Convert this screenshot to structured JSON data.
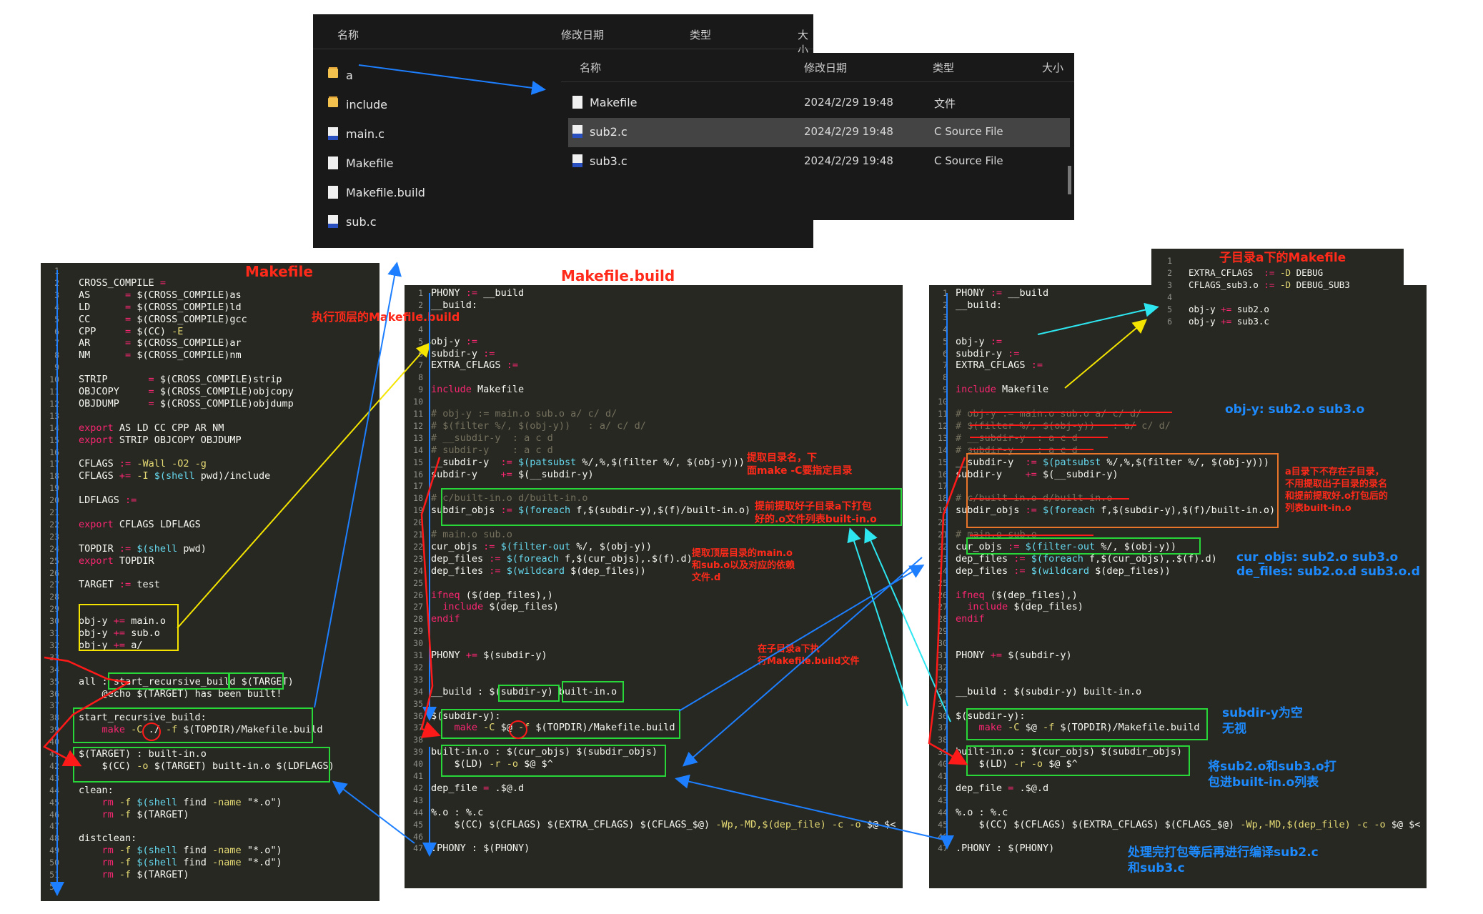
{
  "explorer1": {
    "headers": {
      "name": "名称",
      "date": "修改日期",
      "type": "类型",
      "size": "大小"
    },
    "items": [
      {
        "label": "a",
        "icon": "folder-icon"
      },
      {
        "label": "include",
        "icon": "folder-icon"
      },
      {
        "label": "main.c",
        "icon": "c-file-icon"
      },
      {
        "label": "Makefile",
        "icon": "file-icon"
      },
      {
        "label": "Makefile.build",
        "icon": "file-icon"
      },
      {
        "label": "sub.c",
        "icon": "c-file-icon"
      }
    ]
  },
  "explorer2": {
    "headers": {
      "name": "名称",
      "date": "修改日期",
      "type": "类型",
      "size": "大小"
    },
    "items": [
      {
        "label": "Makefile",
        "date": "2024/2/29 19:48",
        "type": "文件",
        "icon": "file-icon"
      },
      {
        "label": "sub2.c",
        "date": "2024/2/29 19:48",
        "type": "C Source File",
        "icon": "c-file-icon",
        "selected": true
      },
      {
        "label": "sub3.c",
        "date": "2024/2/29 19:48",
        "type": "C Source File",
        "icon": "c-file-icon"
      }
    ]
  },
  "makefile_top": {
    "line_numbers": [
      "1",
      "2",
      "3",
      "4",
      "5",
      "6",
      "7",
      "8",
      "9",
      "10",
      "11",
      "12",
      "13",
      "14",
      "15",
      "16",
      "17",
      "18",
      "19",
      "20",
      "21",
      "22",
      "23",
      "24",
      "25",
      "26",
      "27",
      "28",
      "29",
      "30",
      "31",
      "32",
      "33",
      "34",
      "35",
      "36",
      "37",
      "38",
      "39",
      "40",
      "41",
      "42",
      "43",
      "44",
      "45",
      "46",
      "47",
      "48",
      "49",
      "50",
      "51",
      "52"
    ],
    "lines": [
      {
        "n": 2,
        "t": "CROSS_COMPILE ="
      },
      {
        "n": 3,
        "t": "AS      = $(CROSS_COMPILE)as"
      },
      {
        "n": 4,
        "t": "LD      = $(CROSS_COMPILE)ld"
      },
      {
        "n": 5,
        "t": "CC      = $(CROSS_COMPILE)gcc"
      },
      {
        "n": 6,
        "t": "CPP     = $(CC) -E"
      },
      {
        "n": 7,
        "t": "AR      = $(CROSS_COMPILE)ar"
      },
      {
        "n": 8,
        "t": "NM      = $(CROSS_COMPILE)nm"
      },
      {
        "n": 10,
        "t": "STRIP       = $(CROSS_COMPILE)strip"
      },
      {
        "n": 11,
        "t": "OBJCOPY     = $(CROSS_COMPILE)objcopy"
      },
      {
        "n": 12,
        "t": "OBJDUMP     = $(CROSS_COMPILE)objdump"
      },
      {
        "n": 14,
        "t": "export AS LD CC CPP AR NM"
      },
      {
        "n": 15,
        "t": "export STRIP OBJCOPY OBJDUMP"
      },
      {
        "n": 17,
        "t": "CFLAGS := -Wall -O2 -g"
      },
      {
        "n": 18,
        "t": "CFLAGS += -I $(shell pwd)/include"
      },
      {
        "n": 20,
        "t": "LDFLAGS :="
      },
      {
        "n": 22,
        "t": "export CFLAGS LDFLAGS"
      },
      {
        "n": 24,
        "t": "TOPDIR := $(shell pwd)"
      },
      {
        "n": 25,
        "t": "export TOPDIR"
      },
      {
        "n": 27,
        "t": "TARGET := test"
      },
      {
        "n": 30,
        "t": "obj-y += main.o"
      },
      {
        "n": 31,
        "t": "obj-y += sub.o"
      },
      {
        "n": 32,
        "t": "obj-y += a/"
      },
      {
        "n": 35,
        "t": "all : start_recursive_build $(TARGET)"
      },
      {
        "n": 36,
        "t": "    @echo $(TARGET) has been built!"
      },
      {
        "n": 38,
        "t": "start_recursive_build:"
      },
      {
        "n": 39,
        "t": "    make -C ./ -f $(TOPDIR)/Makefile.build"
      },
      {
        "n": 41,
        "t": "$(TARGET) : built-in.o"
      },
      {
        "n": 42,
        "t": "    $(CC) -o $(TARGET) built-in.o $(LDFLAGS)"
      },
      {
        "n": 44,
        "t": "clean:"
      },
      {
        "n": 45,
        "t": "    rm -f $(shell find -name \"*.o\")"
      },
      {
        "n": 46,
        "t": "    rm -f $(TARGET)"
      },
      {
        "n": 48,
        "t": "distclean:"
      },
      {
        "n": 49,
        "t": "    rm -f $(shell find -name \"*.o\")"
      },
      {
        "n": 50,
        "t": "    rm -f $(shell find -name \"*.d\")"
      },
      {
        "n": 51,
        "t": "    rm -f $(TARGET)"
      }
    ]
  },
  "makefile_build": {
    "lines": [
      {
        "n": 1,
        "t": "PHONY := __build"
      },
      {
        "n": 2,
        "t": "__build:"
      },
      {
        "n": 5,
        "t": "obj-y :="
      },
      {
        "n": 6,
        "t": "subdir-y :="
      },
      {
        "n": 7,
        "t": "EXTRA_CFLAGS :="
      },
      {
        "n": 9,
        "t": "include Makefile"
      },
      {
        "n": 11,
        "t": "# obj-y := main.o sub.o a/ c/ d/"
      },
      {
        "n": 12,
        "t": "# $(filter %/, $(obj-y))   : a/ c/ d/"
      },
      {
        "n": 13,
        "t": "# __subdir-y  : a c d"
      },
      {
        "n": 14,
        "t": "# subdir-y    : a c d"
      },
      {
        "n": 15,
        "t": "__subdir-y  := $(patsubst %/,%,$(filter %/, $(obj-y)))"
      },
      {
        "n": 16,
        "t": "subdir-y    += $(__subdir-y)"
      },
      {
        "n": 18,
        "t": "# c/built-in.o d/built-in.o"
      },
      {
        "n": 19,
        "t": "subdir_objs := $(foreach f,$(subdir-y),$(f)/built-in.o)"
      },
      {
        "n": 21,
        "t": "# main.o sub.o"
      },
      {
        "n": 22,
        "t": "cur_objs := $(filter-out %/, $(obj-y))"
      },
      {
        "n": 23,
        "t": "dep_files := $(foreach f,$(cur_objs),.$(f).d)"
      },
      {
        "n": 24,
        "t": "dep_files := $(wildcard $(dep_files))"
      },
      {
        "n": 26,
        "t": "ifneq ($(dep_files),)"
      },
      {
        "n": 27,
        "t": "  include $(dep_files)"
      },
      {
        "n": 28,
        "t": "endif"
      },
      {
        "n": 31,
        "t": "PHONY += $(subdir-y)"
      },
      {
        "n": 34,
        "t": "__build : $(subdir-y) built-in.o"
      },
      {
        "n": 36,
        "t": "$(subdir-y):"
      },
      {
        "n": 37,
        "t": "    make -C $@ -f $(TOPDIR)/Makefile.build"
      },
      {
        "n": 39,
        "t": "built-in.o : $(cur_objs) $(subdir_objs)"
      },
      {
        "n": 40,
        "t": "    $(LD) -r -o $@ $^"
      },
      {
        "n": 42,
        "t": "dep_file = .$@.d"
      },
      {
        "n": 44,
        "t": "%.o : %.c"
      },
      {
        "n": 45,
        "t": "    $(CC) $(CFLAGS) $(EXTRA_CFLAGS) $(CFLAGS_$@) -Wp,-MD,$(dep_file) -c -o $@ $<"
      },
      {
        "n": 47,
        "t": ".PHONY : $(PHONY)"
      }
    ]
  },
  "sub_makefile": {
    "lines": [
      {
        "n": 2,
        "t": "EXTRA_CFLAGS  := -D DEBUG"
      },
      {
        "n": 3,
        "t": "CFLAGS_sub3.o := -D DEBUG_SUB3"
      },
      {
        "n": 5,
        "t": "obj-y += sub2.o"
      },
      {
        "n": 6,
        "t": "obj-y += sub3.c"
      }
    ]
  },
  "annotations": {
    "makefile_title": "Makefile",
    "makefile_build_title": "Makefile.build",
    "exec_top": "执行顶层的Makefile.build",
    "extract_dirname": "提取目录名，下\n面make -C要指定目录",
    "pre_extract": "提前提取好子目录a下打包\n好的.o文件列表built-in.o",
    "extract_main": "提取顶层目录的main.o\n和sub.o以及对应的依赖\n文件.d",
    "exec_sub": "在子目录a下执\n行Makefile.build文件",
    "sub_makefile_title": "子目录a下的Makefile",
    "obj_y": "obj-y:  sub2.o sub3.o",
    "no_subdir": "a目录下不存在子目录，\n不用提取出子目录的录名\n和提前提取好.o打包后的\n列表built-in.o",
    "cur_objs": "cur_objs: sub2.o sub3.o",
    "de_files": "de_files: sub2.o.d sub3.o.d",
    "subdir_empty": "subdir-y为空\n  无视",
    "pack": "将sub2.o和sub3.o打\n包进built-in.o列表",
    "compile": "处理完打包等后再进行编译sub2.c\n和sub3.c"
  }
}
